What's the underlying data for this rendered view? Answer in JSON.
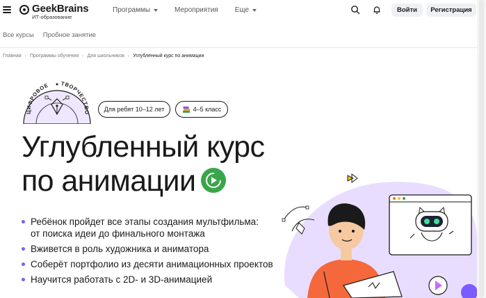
{
  "header": {
    "logo_title": "GeekBrains",
    "logo_subtitle": "ИТ-образование",
    "nav": [
      {
        "label": "Программы",
        "has_dropdown": true
      },
      {
        "label": "Мероприятия",
        "has_dropdown": false
      },
      {
        "label": "Еще",
        "has_dropdown": true
      }
    ],
    "login_label": "Войти",
    "register_label": "Регистрация",
    "icons": [
      "menu-icon",
      "search-icon",
      "bell-icon"
    ]
  },
  "subnav": [
    "Все курсы",
    "Пробное занятие"
  ],
  "breadcrumbs": [
    "Главная",
    "Программы обучения",
    "Для школьников",
    "Углубленный курс по анимации"
  ],
  "badge": {
    "text_left": "ЦИФРОВОЕ",
    "text_right": "ТВОРЧЕСТВО"
  },
  "tags": [
    {
      "label": "Для ребят 10–12 лет"
    },
    {
      "label": "4–5 класс",
      "icon": "books-icon"
    }
  ],
  "headline": {
    "line1": "Углубленный курс",
    "line2": "по анимации"
  },
  "bullets": [
    {
      "line1": "Ребёнок пройдет все этапы создания мультфильма:",
      "line2": "от поиска идеи до финального монтажа"
    },
    {
      "line1": "Вживется в роль художника и аниматора"
    },
    {
      "line1": "Соберёт портфолио из десяти анимационных проектов"
    },
    {
      "line1": "Научится работать с 2D- и 3D-анимацией"
    }
  ],
  "colors": {
    "accent": "#7b5cff",
    "green": "#3aa64a",
    "shirt": "#f4683c",
    "blob": "#e9ddff",
    "badge_bg": "#efe6ff"
  }
}
